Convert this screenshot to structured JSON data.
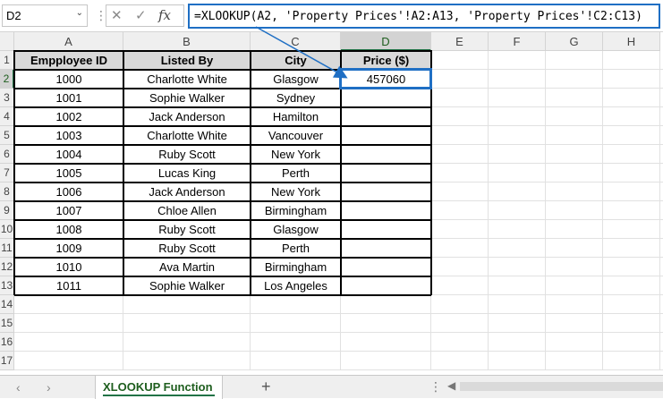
{
  "name_box": "D2",
  "formula": "=XLOOKUP(A2, 'Property Prices'!A2:A13, 'Property Prices'!C2:C13)",
  "columns": [
    "A",
    "B",
    "C",
    "D",
    "E",
    "F",
    "G",
    "H"
  ],
  "rows": [
    "1",
    "2",
    "3",
    "4",
    "5",
    "6",
    "7",
    "8",
    "9",
    "10",
    "11",
    "12",
    "13",
    "14",
    "15",
    "16",
    "17"
  ],
  "table": {
    "headers": [
      "Empployee ID",
      "Listed By",
      "City",
      "Price ($)"
    ],
    "rows": [
      [
        "1000",
        "Charlotte White",
        "Glasgow",
        "457060"
      ],
      [
        "1001",
        "Sophie Walker",
        "Sydney",
        ""
      ],
      [
        "1002",
        "Jack Anderson",
        "Hamilton",
        ""
      ],
      [
        "1003",
        "Charlotte White",
        "Vancouver",
        ""
      ],
      [
        "1004",
        "Ruby Scott",
        "New York",
        ""
      ],
      [
        "1005",
        "Lucas King",
        "Perth",
        ""
      ],
      [
        "1006",
        "Jack Anderson",
        "New York",
        ""
      ],
      [
        "1007",
        "Chloe Allen",
        "Birmingham",
        ""
      ],
      [
        "1008",
        "Ruby Scott",
        "Glasgow",
        ""
      ],
      [
        "1009",
        "Ruby Scott",
        "Perth",
        ""
      ],
      [
        "1010",
        "Ava Martin",
        "Birmingham",
        ""
      ],
      [
        "1011",
        "Sophie Walker",
        "Los Angeles",
        ""
      ]
    ]
  },
  "sheet_tab": "XLOOKUP  Function",
  "colors": {
    "accent": "#1f6fc4",
    "excel_green": "#217346",
    "header_fill": "#d9d9d9"
  },
  "icons": {
    "cancel": "close-icon",
    "enter": "check-icon",
    "function": "fx-icon",
    "add_sheet": "plus-icon"
  }
}
